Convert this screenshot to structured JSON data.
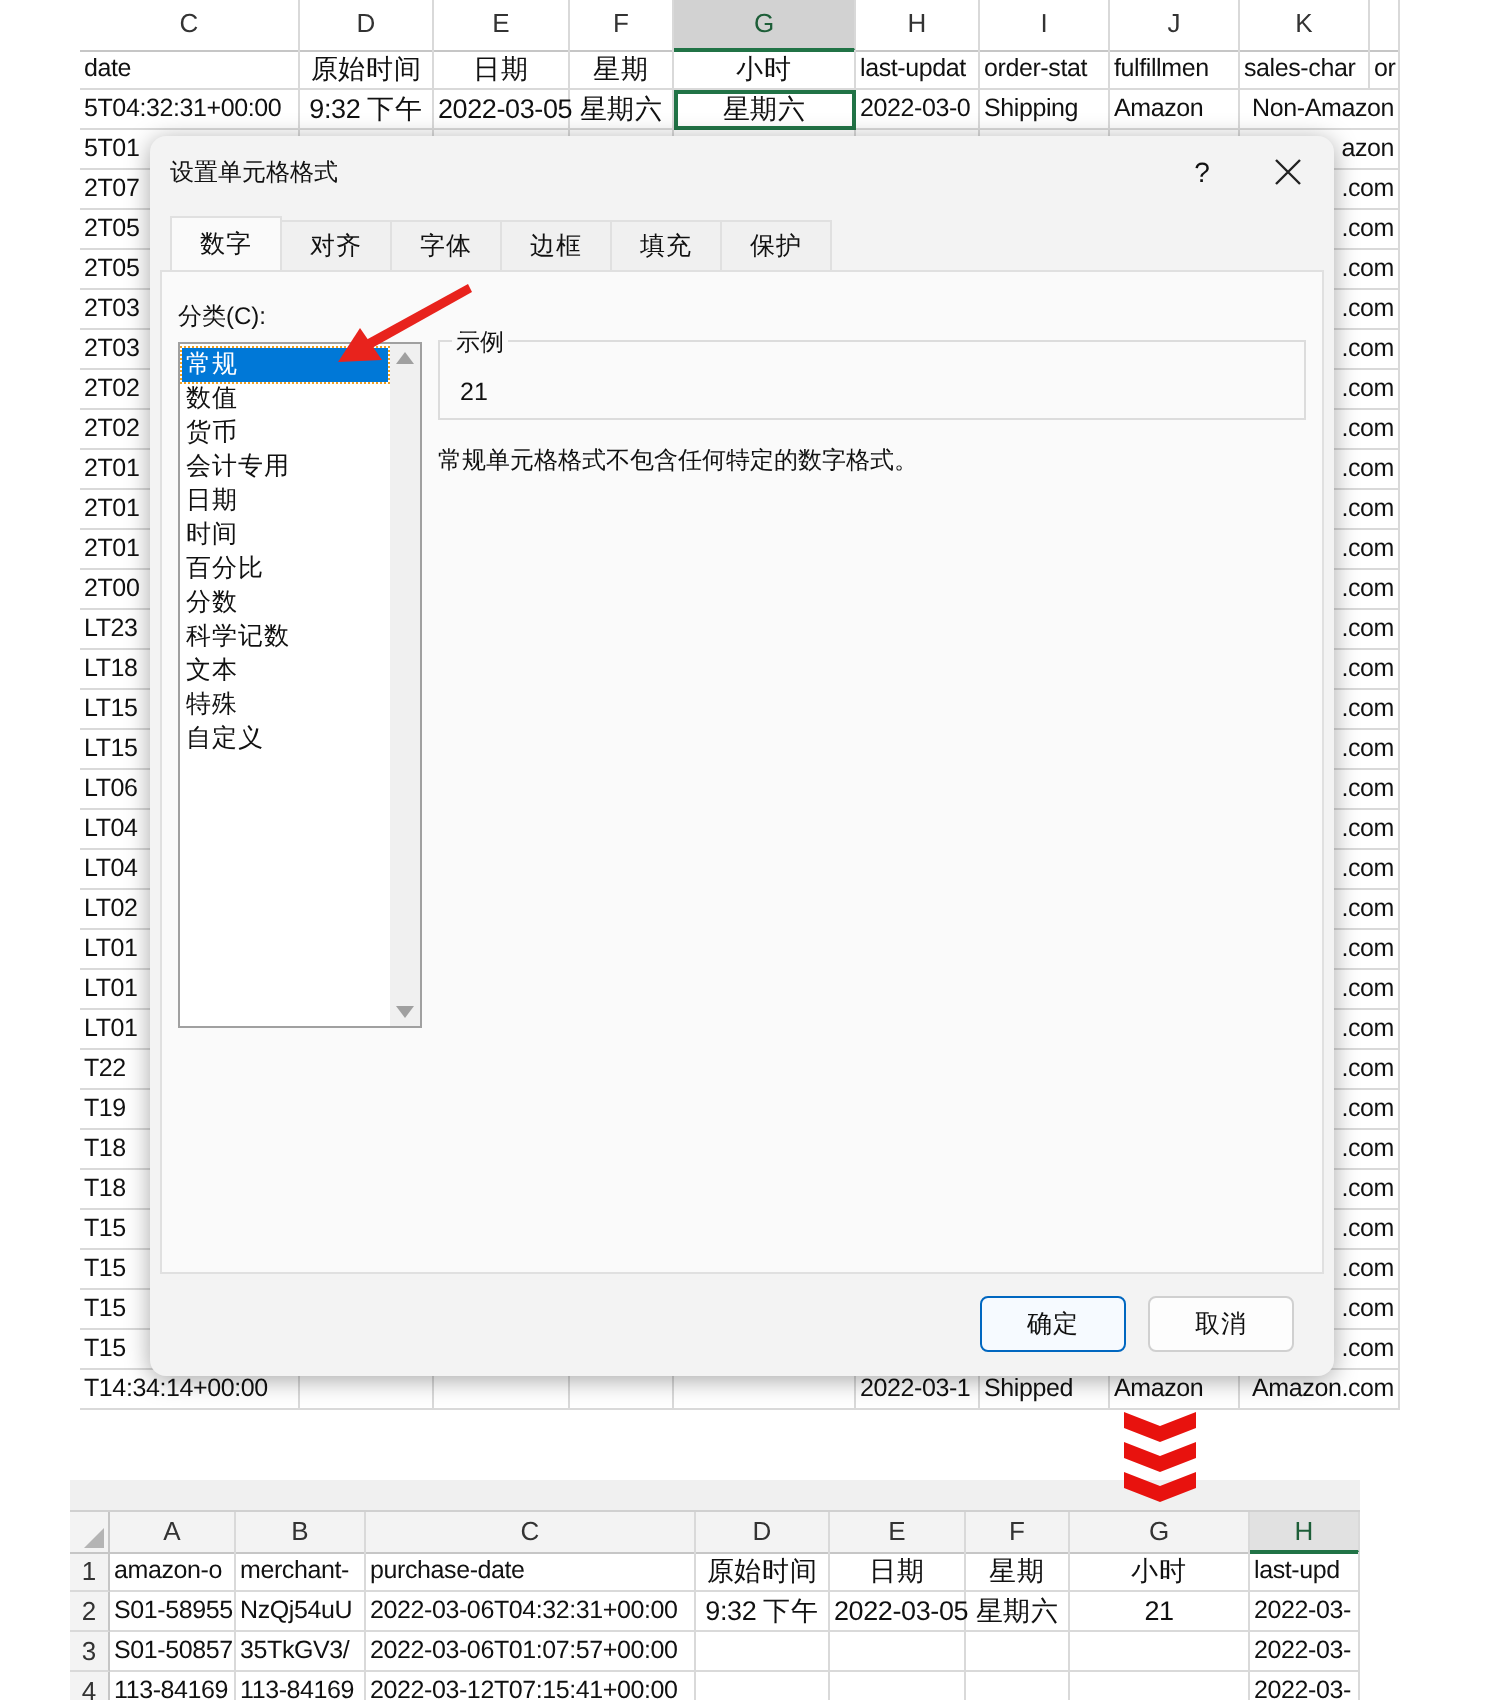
{
  "top_sheet": {
    "columns": [
      {
        "letter": "C",
        "selected": false
      },
      {
        "letter": "D",
        "selected": false
      },
      {
        "letter": "E",
        "selected": false
      },
      {
        "letter": "F",
        "selected": false
      },
      {
        "letter": "G",
        "selected": true
      },
      {
        "letter": "H",
        "selected": false
      },
      {
        "letter": "I",
        "selected": false
      },
      {
        "letter": "J",
        "selected": false
      },
      {
        "letter": "K",
        "selected": false
      },
      {
        "selected": false
      }
    ],
    "rows": [
      {
        "cells": {
          "c1": "date",
          "c2": "原始时间",
          "c3": "日期",
          "c4": "星期",
          "c5": "小时",
          "c6": "last-updat",
          "c7": "order-stat",
          "c8": "fulfillmen",
          "c9": "sales-char",
          "c10": "or"
        }
      },
      {
        "cells": {
          "c1": "5T04:32:31+00:00",
          "c2": "9:32 下午",
          "c3": "2022-03-05",
          "c4": "星期六",
          "c5": {
            "text": "星期六",
            "active": true
          },
          "c6": "2022-03-0",
          "c7": "Shipping",
          "c8": "Amazon",
          "c9": "Non-Amazon"
        }
      },
      {
        "cells": {
          "c1": "5T01",
          "c9": "azon"
        }
      },
      {
        "cells": {
          "c1": "2T07",
          "c9": ".com"
        }
      },
      {
        "cells": {
          "c1": "2T05",
          "c9": ".com"
        }
      },
      {
        "cells": {
          "c1": "2T05",
          "c9": ".com"
        }
      },
      {
        "cells": {
          "c1": "2T03",
          "c9": ".com"
        }
      },
      {
        "cells": {
          "c1": "2T03",
          "c9": ".com"
        }
      },
      {
        "cells": {
          "c1": "2T02",
          "c9": ".com"
        }
      },
      {
        "cells": {
          "c1": "2T02",
          "c9": ".com"
        }
      },
      {
        "cells": {
          "c1": "2T01",
          "c9": ".com"
        }
      },
      {
        "cells": {
          "c1": "2T01",
          "c9": ".com"
        }
      },
      {
        "cells": {
          "c1": "2T01",
          "c9": ".com"
        }
      },
      {
        "cells": {
          "c1": "2T00",
          "c9": ".com"
        }
      },
      {
        "cells": {
          "c1": "LT23",
          "c9": ".com"
        }
      },
      {
        "cells": {
          "c1": "LT18",
          "c9": ".com"
        }
      },
      {
        "cells": {
          "c1": "LT15",
          "c9": ".com"
        }
      },
      {
        "cells": {
          "c1": "LT15",
          "c9": ".com"
        }
      },
      {
        "cells": {
          "c1": "LT06",
          "c9": ".com"
        }
      },
      {
        "cells": {
          "c1": "LT04",
          "c9": ".com"
        }
      },
      {
        "cells": {
          "c1": "LT04",
          "c9": ".com"
        }
      },
      {
        "cells": {
          "c1": "LT02",
          "c9": ".com"
        }
      },
      {
        "cells": {
          "c1": "LT01",
          "c9": ".com"
        }
      },
      {
        "cells": {
          "c1": "LT01",
          "c9": ".com"
        }
      },
      {
        "cells": {
          "c1": "LT01",
          "c9": ".com"
        }
      },
      {
        "cells": {
          "c1": "T22",
          "c9": ".com"
        }
      },
      {
        "cells": {
          "c1": "T19",
          "c9": ".com"
        }
      },
      {
        "cells": {
          "c1": "T18",
          "c9": ".com"
        }
      },
      {
        "cells": {
          "c1": "T18",
          "c9": ".com"
        }
      },
      {
        "cells": {
          "c1": "T15",
          "c9": ".com"
        }
      },
      {
        "cells": {
          "c1": "T15",
          "c9": ".com"
        }
      },
      {
        "cells": {
          "c1": "T15",
          "c9": ".com"
        }
      },
      {
        "cells": {
          "c1": "T15",
          "c9": ".com"
        }
      },
      {
        "cells": {
          "c1": "T14:34:14+00:00",
          "c6": "2022-03-1",
          "c7": "Shipped",
          "c8": "Amazon",
          "c9": "Amazon.com"
        }
      }
    ]
  },
  "dialog": {
    "title": "设置单元格格式",
    "help": "?",
    "tabs": [
      {
        "label": "数字",
        "selected": true
      },
      {
        "label": "对齐",
        "selected": false
      },
      {
        "label": "字体",
        "selected": false
      },
      {
        "label": "边框",
        "selected": false
      },
      {
        "label": "填充",
        "selected": false
      },
      {
        "label": "保护",
        "selected": false
      }
    ],
    "category_label": "分类(C):",
    "categories": [
      {
        "label": "常规",
        "selected": true
      },
      {
        "label": "数值",
        "selected": false
      },
      {
        "label": "货币",
        "selected": false
      },
      {
        "label": "会计专用",
        "selected": false
      },
      {
        "label": "日期",
        "selected": false
      },
      {
        "label": "时间",
        "selected": false
      },
      {
        "label": "百分比",
        "selected": false
      },
      {
        "label": "分数",
        "selected": false
      },
      {
        "label": "科学记数",
        "selected": false
      },
      {
        "label": "文本",
        "selected": false
      },
      {
        "label": "特殊",
        "selected": false
      },
      {
        "label": "自定义",
        "selected": false
      }
    ],
    "sample": {
      "legend": "示例",
      "value": "21"
    },
    "description": "常规单元格格式不包含任何特定的数字格式。",
    "buttons": [
      {
        "label": "确定",
        "default": true
      },
      {
        "label": "取消",
        "default": false
      }
    ]
  },
  "bottom_sheet": {
    "columns": [
      {
        "letter": "A",
        "selected": false
      },
      {
        "letter": "B",
        "selected": false
      },
      {
        "letter": "C",
        "selected": false
      },
      {
        "letter": "D",
        "selected": false
      },
      {
        "letter": "E",
        "selected": false
      },
      {
        "letter": "F",
        "selected": false
      },
      {
        "letter": "G",
        "selected": false
      },
      {
        "letter": "H",
        "selected": true
      }
    ],
    "rows": [
      {
        "number": "1",
        "cells": {
          "c1": "amazon-o",
          "c2": "merchant-",
          "c3": "purchase-date",
          "c4": "原始时间",
          "c5": "日期",
          "c6": "星期",
          "c7": "小时",
          "c8": "last-upd"
        }
      },
      {
        "number": "2",
        "cells": {
          "c1": "S01-58955",
          "c2": "NzQj54uU",
          "c3": "2022-03-06T04:32:31+00:00",
          "c4": "9:32 下午",
          "c5": "2022-03-05",
          "c6": "星期六",
          "c7": "21",
          "c8": "2022-03-"
        }
      },
      {
        "number": "3",
        "cells": {
          "c1": "S01-50857",
          "c2": "35TkGV3/",
          "c3": "2022-03-06T01:07:57+00:00",
          "c8": "2022-03-"
        }
      },
      {
        "number": "4",
        "cells": {
          "c1": "113-84169",
          "c2": "113-84169",
          "c3": "2022-03-12T07:15:41+00:00",
          "c8": "2022-03-"
        }
      }
    ]
  }
}
